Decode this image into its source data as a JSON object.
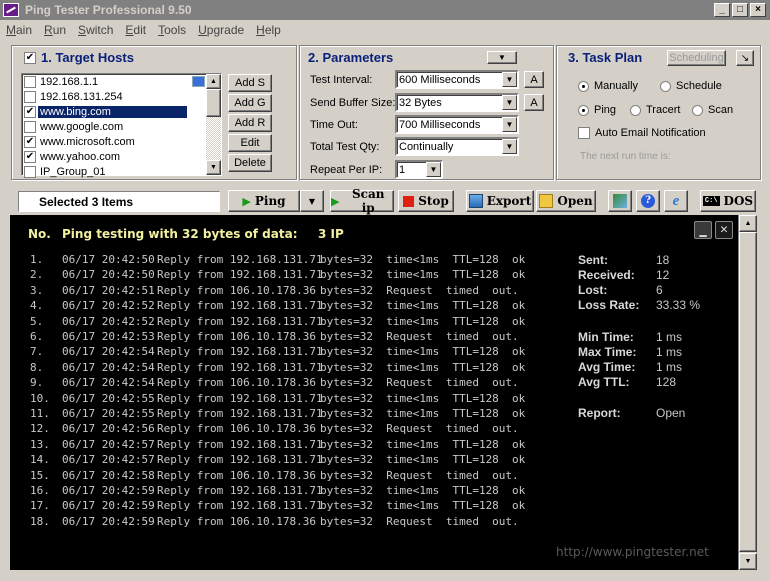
{
  "window": {
    "title": "Ping Tester   Professional  9.50"
  },
  "menu": [
    "Main",
    "Run",
    "Switch",
    "Edit",
    "Tools",
    "Upgrade",
    "Help"
  ],
  "target_hosts": {
    "title": "1. Target Hosts",
    "checked": true,
    "hosts": [
      {
        "label": "192.168.1.1",
        "checked": false,
        "selected": false
      },
      {
        "label": "192.168.131.254",
        "checked": false,
        "selected": false
      },
      {
        "label": "www.bing.com",
        "checked": true,
        "selected": true
      },
      {
        "label": "www.google.com",
        "checked": false,
        "selected": false
      },
      {
        "label": "www.microsoft.com",
        "checked": true,
        "selected": false
      },
      {
        "label": "www.yahoo.com",
        "checked": true,
        "selected": false
      },
      {
        "label": "IP_Group_01",
        "checked": false,
        "selected": false
      }
    ],
    "buttons": {
      "add_s": "Add S",
      "add_g": "Add G",
      "add_r": "Add R",
      "edit": "Edit",
      "delete": "Delete"
    }
  },
  "parameters": {
    "title": "2. Parameters",
    "test_interval": {
      "label": "Test Interval:",
      "value": "600  Milliseconds"
    },
    "send_buffer": {
      "label": "Send Buffer Size:",
      "value": "32  Bytes"
    },
    "time_out": {
      "label": "Time Out:",
      "value": "700  Milliseconds"
    },
    "total_qty": {
      "label": "Total Test Qty:",
      "value": "Continually"
    },
    "repeat": {
      "label": "Repeat Per IP:",
      "value": "1"
    },
    "a_button": "A"
  },
  "task_plan": {
    "title": "3. Task Plan",
    "scheduling_button": "Scheduling",
    "manually": "Manually",
    "schedule": "Schedule",
    "ping": "Ping",
    "tracert": "Tracert",
    "scan": "Scan",
    "auto_email": "Auto Email Notification",
    "next_run": "The next run time is:"
  },
  "toolbar": {
    "status": "Selected 3 Items",
    "ping": "Ping",
    "scan_ip": "Scan ip",
    "stop": "Stop",
    "export": "Export",
    "open": "Open",
    "dos": "DOS"
  },
  "console": {
    "header_no": "No.",
    "header_text": "Ping testing with 32 bytes of data:",
    "header_ip": "3  IP",
    "rows": [
      {
        "no": "1.",
        "time": "06/17 20:42:50",
        "from": "Reply from 192.168.131.71",
        "result": "bytes=32  time<1ms  TTL=128  ok"
      },
      {
        "no": "2.",
        "time": "06/17 20:42:50",
        "from": "Reply from 192.168.131.71",
        "result": "bytes=32  time<1ms  TTL=128  ok"
      },
      {
        "no": "3.",
        "time": "06/17 20:42:51",
        "from": "Reply from 106.10.178.36",
        "result": "bytes=32  Request  timed  out."
      },
      {
        "no": "4.",
        "time": "06/17 20:42:52",
        "from": "Reply from 192.168.131.71",
        "result": "bytes=32  time<1ms  TTL=128  ok"
      },
      {
        "no": "5.",
        "time": "06/17 20:42:52",
        "from": "Reply from 192.168.131.71",
        "result": "bytes=32  time<1ms  TTL=128  ok"
      },
      {
        "no": "6.",
        "time": "06/17 20:42:53",
        "from": "Reply from 106.10.178.36",
        "result": "bytes=32  Request  timed  out."
      },
      {
        "no": "7.",
        "time": "06/17 20:42:54",
        "from": "Reply from 192.168.131.71",
        "result": "bytes=32  time<1ms  TTL=128  ok"
      },
      {
        "no": "8.",
        "time": "06/17 20:42:54",
        "from": "Reply from 192.168.131.71",
        "result": "bytes=32  time<1ms  TTL=128  ok"
      },
      {
        "no": "9.",
        "time": "06/17 20:42:54",
        "from": "Reply from 106.10.178.36",
        "result": "bytes=32  Request  timed  out."
      },
      {
        "no": "10.",
        "time": "06/17 20:42:55",
        "from": "Reply from 192.168.131.71",
        "result": "bytes=32  time<1ms  TTL=128  ok"
      },
      {
        "no": "11.",
        "time": "06/17 20:42:55",
        "from": "Reply from 192.168.131.71",
        "result": "bytes=32  time<1ms  TTL=128  ok"
      },
      {
        "no": "12.",
        "time": "06/17 20:42:56",
        "from": "Reply from 106.10.178.36",
        "result": "bytes=32  Request  timed  out."
      },
      {
        "no": "13.",
        "time": "06/17 20:42:57",
        "from": "Reply from 192.168.131.71",
        "result": "bytes=32  time<1ms  TTL=128  ok"
      },
      {
        "no": "14.",
        "time": "06/17 20:42:57",
        "from": "Reply from 192.168.131.71",
        "result": "bytes=32  time<1ms  TTL=128  ok"
      },
      {
        "no": "15.",
        "time": "06/17 20:42:58",
        "from": "Reply from 106.10.178.36",
        "result": "bytes=32  Request  timed  out."
      },
      {
        "no": "16.",
        "time": "06/17 20:42:59",
        "from": "Reply from 192.168.131.71",
        "result": "bytes=32  time<1ms  TTL=128  ok"
      },
      {
        "no": "17.",
        "time": "06/17 20:42:59",
        "from": "Reply from 192.168.131.71",
        "result": "bytes=32  time<1ms  TTL=128  ok"
      },
      {
        "no": "18.",
        "time": "06/17 20:42:59",
        "from": "Reply from 106.10.178.36",
        "result": "bytes=32  Request  timed  out."
      }
    ],
    "stats": [
      {
        "key": "Sent:",
        "value": "18"
      },
      {
        "key": "Received:",
        "value": "12"
      },
      {
        "key": "Lost:",
        "value": "6"
      },
      {
        "key": "Loss Rate:",
        "value": "33.33 %"
      },
      {
        "key": "Min Time:",
        "value": "1 ms"
      },
      {
        "key": "Max Time:",
        "value": "1 ms"
      },
      {
        "key": "Avg Time:",
        "value": "1 ms"
      },
      {
        "key": "Avg TTL:",
        "value": "128"
      },
      {
        "key": "Report:",
        "value": "Open"
      }
    ],
    "url": "http://www.pingtester.net"
  },
  "colors": {
    "title_blue": "#0a1f7a",
    "console_bg": "#000000",
    "console_header": "#f0f0a0",
    "selection": "#0a246a"
  }
}
